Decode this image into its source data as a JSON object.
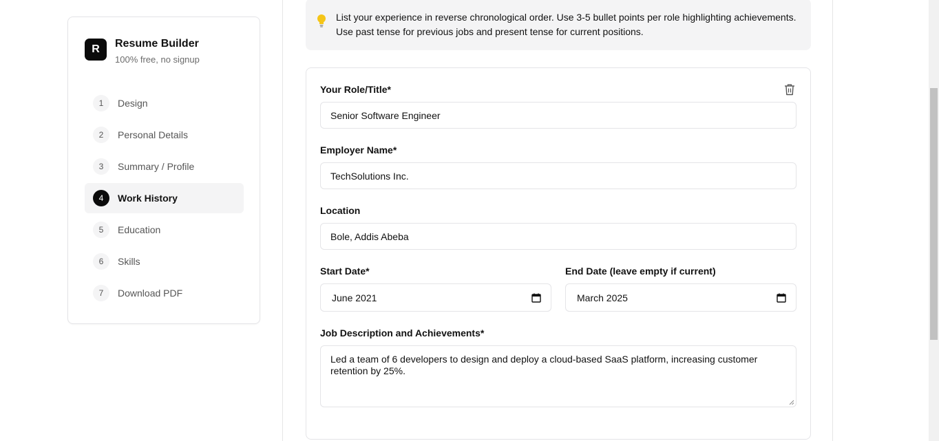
{
  "sidebar": {
    "logo_letter": "R",
    "title": "Resume Builder",
    "subtitle": "100% free, no signup",
    "steps": [
      {
        "num": "1",
        "label": "Design"
      },
      {
        "num": "2",
        "label": "Personal Details"
      },
      {
        "num": "3",
        "label": "Summary / Profile"
      },
      {
        "num": "4",
        "label": "Work History"
      },
      {
        "num": "5",
        "label": "Education"
      },
      {
        "num": "6",
        "label": "Skills"
      },
      {
        "num": "7",
        "label": "Download PDF"
      }
    ],
    "active_step": "4"
  },
  "tip": {
    "icon": "lightbulb-icon",
    "text": "List your experience in reverse chronological order. Use 3-5 bullet points per role highlighting achievements. Use past tense for previous jobs and present tense for current positions."
  },
  "form": {
    "role_label": "Your Role/Title*",
    "role_value": "Senior Software Engineer",
    "employer_label": "Employer Name*",
    "employer_value": "TechSolutions Inc.",
    "location_label": "Location",
    "location_value": "Bole, Addis Abeba",
    "start_label": "Start Date*",
    "start_value": "June 2021",
    "end_label": "End Date (leave empty if current)",
    "end_value": "March 2025",
    "description_label": "Job Description and Achievements*",
    "description_value": "Led a team of 6 developers to design and deploy a cloud-based SaaS platform, increasing customer retention by 25%.",
    "delete_icon": "trash-icon",
    "calendar_icon": "calendar-icon"
  },
  "colors": {
    "accent": "#0b0b0b",
    "tip_bulb": "#f5c518",
    "panel_bg": "#f4f4f5",
    "border": "#e4e4e7"
  }
}
